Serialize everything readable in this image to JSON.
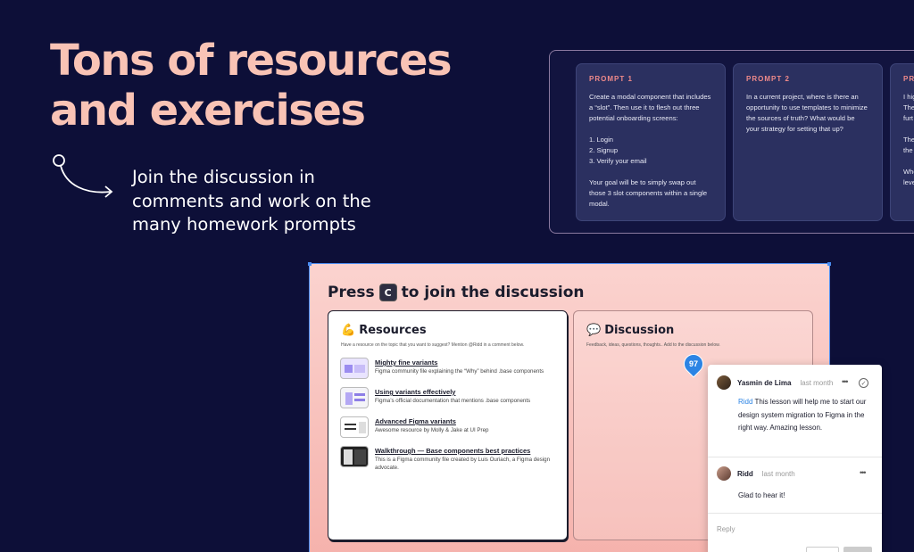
{
  "headline": {
    "line1": "Tons of resources",
    "line2": "and exercises"
  },
  "subhead": {
    "line1": "Join the discussion in",
    "line2": "comments and work on the",
    "line3": "many homework prompts"
  },
  "prompts": [
    {
      "title": "PROMPT 1",
      "body": "Create a modal component that includes a “slot”. Then use it to flesh out three potential onboarding screens:\n\n1. Login\n2. Signup\n3. Verify your email\n\nYour goal will be to simply swap out those 3 slot components within a single modal."
    },
    {
      "title": "PROMPT 2",
      "body": "In a current project, where is there an opportunity to use templates to minimize the sources of truth? What would be your strategy for setting that up?"
    },
    {
      "title": "PROMPT",
      "body": "I hig\nThey\nfurt\n\nThe\nthe\n\nWhe\nleve"
    }
  ],
  "board": {
    "title_pre": "Press",
    "key": "C",
    "title_post": "to join the discussion",
    "resources": {
      "emoji": "💪",
      "title": "Resources",
      "subtitle": "Have a resource on the topic that you want to suggest? Mention @Ridd in a comment below.",
      "items": [
        {
          "title": "Mighty fine variants",
          "desc": "Figma community file explaining the “Why” behind .base components"
        },
        {
          "title": "Using variants effectively",
          "desc": "Figma’s official documentation that mentions .base components"
        },
        {
          "title": "Advanced Figma variants",
          "desc": "Awesome resource by Molly & Jake at UI Prep"
        },
        {
          "title": "Walkthrough — Base components best practices",
          "desc": "This is a Figma community file created by Luis Ouriach, a Figma design advocate."
        }
      ]
    },
    "discussion": {
      "emoji": "💬",
      "title": "Discussion",
      "subtitle": "Feedback, ideas, questions, thoughts.. Add to the discussion below."
    }
  },
  "pin": {
    "count": "97"
  },
  "comments": {
    "items": [
      {
        "author": "Yasmin de Lima",
        "time": "last month",
        "mention": "Ridd",
        "text": " This lesson will help me to start our design system migration to Figma in the right way. Amazing lesson."
      },
      {
        "author": "Ridd",
        "time": "last month",
        "mention": "",
        "text": "Glad to hear it!"
      }
    ],
    "reply_placeholder": "Reply"
  }
}
